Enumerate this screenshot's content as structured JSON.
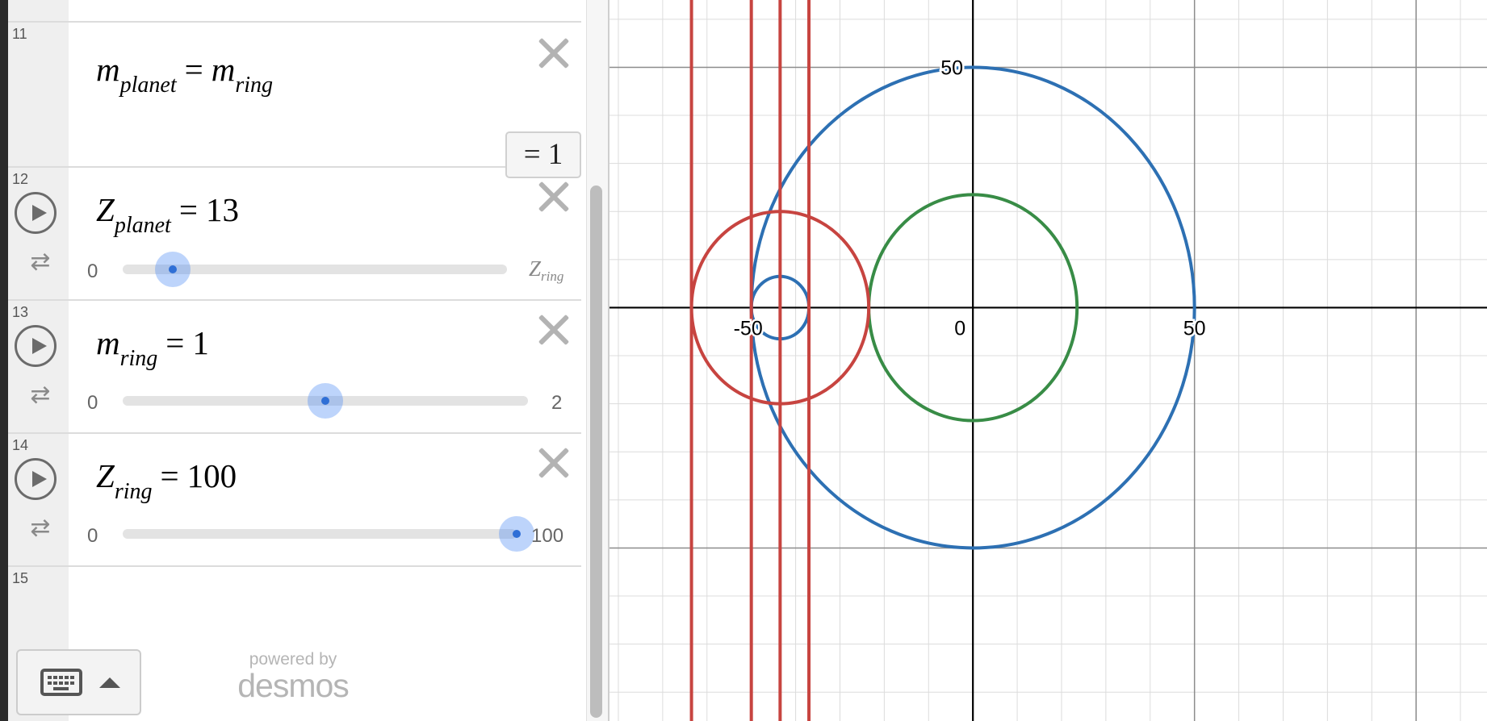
{
  "expressions": [
    {
      "number": "11",
      "lhs": "m",
      "lhs_sub": "planet",
      "op": "=",
      "rhs": "m",
      "rhs_sub": "ring",
      "evaluation": "= 1"
    },
    {
      "number": "12",
      "lhs": "Z",
      "lhs_sub": "planet",
      "op": "=",
      "value": "13",
      "slider": {
        "min": "0",
        "max": "Z",
        "max_sub": "ring",
        "value": 13,
        "range": [
          0,
          100
        ]
      }
    },
    {
      "number": "13",
      "lhs": "m",
      "lhs_sub": "ring",
      "op": "=",
      "value": "1",
      "slider": {
        "min": "0",
        "max": "2",
        "value": 1,
        "range": [
          0,
          2
        ]
      }
    },
    {
      "number": "14",
      "lhs": "Z",
      "lhs_sub": "ring",
      "op": "=",
      "value": "100",
      "slider": {
        "min": "0",
        "max": "100",
        "value": 100,
        "range": [
          0,
          100
        ]
      }
    },
    {
      "number": "15"
    }
  ],
  "icons": {
    "delete": "close-icon",
    "play": "play-icon",
    "loop": "loop-icon",
    "keyboard": "keyboard-icon",
    "caret": "caret-up-icon"
  },
  "footer": {
    "powered_by": "powered by",
    "brand": "desmos"
  },
  "graph": {
    "tick_labels": {
      "x_neg": "-50",
      "x_zero": "0",
      "x_pos": "50",
      "y_pos": "50"
    },
    "view": {
      "x_range": [
        -82,
        116
      ],
      "y_range": [
        -86,
        64
      ]
    },
    "grid_minor_step": 10,
    "grid_major_step": 50,
    "curves": [
      {
        "kind": "circle",
        "cx": 0,
        "cy": 0,
        "r": 50,
        "color": "#2d70b3"
      },
      {
        "kind": "circle",
        "cx": 0,
        "cy": 0,
        "r": 23.5,
        "color": "#388c46"
      },
      {
        "kind": "circle",
        "cx": -43.5,
        "cy": 0,
        "r": 20,
        "color": "#c74440"
      },
      {
        "kind": "circle",
        "cx": -43.5,
        "cy": 0,
        "r": 6.5,
        "color": "#2d70b3"
      },
      {
        "kind": "vline",
        "x": -63.5,
        "color": "#c74440"
      },
      {
        "kind": "vline",
        "x": -50,
        "color": "#c74440"
      },
      {
        "kind": "vline",
        "x": -43.5,
        "color": "#c74440"
      },
      {
        "kind": "vline",
        "x": -37,
        "color": "#c74440"
      }
    ]
  }
}
